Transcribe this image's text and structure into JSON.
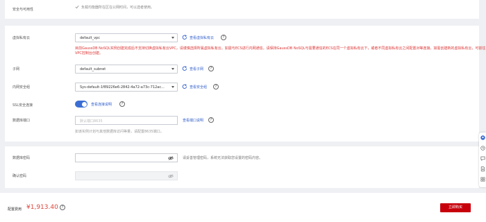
{
  "security": {
    "label": "安全与可用性",
    "checkbox_text": "负载均衡器所在区在公网时间，可以选者使用。"
  },
  "vpc": {
    "label": "虚拟私有云",
    "value": "default_vpc",
    "link": "查看虚拟私有云",
    "warning": "目前GaussDB NoSQL实例创建完成后不支持切换虚拟私有云VPC，请谨慎选择所属虚拟私有云。如需与ECS进行内网通信，请保持GaussDB NoSQL与需要通信的ECS在同一个虚拟私有云下，或者不同虚拟私有云之间配置对等连接。如需创建新的虚拟私有云，可前往VPC控制台创建。"
  },
  "subnet": {
    "label": "子网",
    "value": "default_subnet",
    "link": "查看子网"
  },
  "security_group": {
    "label": "内网安全组",
    "value": "Sys-default-1f89226e6-2842-4a72-a73c-712ac...",
    "link": "查看安全组"
  },
  "ssl": {
    "label": "SSL安全连接",
    "enabled": true,
    "link": "查看连接说明"
  },
  "db_port": {
    "label": "数据库端口",
    "placeholder": "默认端口8635",
    "link": "查看端口说明",
    "hint": "如该实例计划与其他数据库访问等量，请配置8635端口。"
  },
  "password": {
    "label": "数据库密码",
    "hint": "请妥善管理密码，系统无法获取您设置的密码内容。"
  },
  "confirm_password": {
    "label": "确认密码"
  },
  "footer": {
    "price_label": "配置费用",
    "price": "¥1,913.40",
    "submit": "立即购买"
  },
  "colors": {
    "accent": "#3361cc",
    "danger": "#c7000b",
    "price": "#e0453a"
  }
}
